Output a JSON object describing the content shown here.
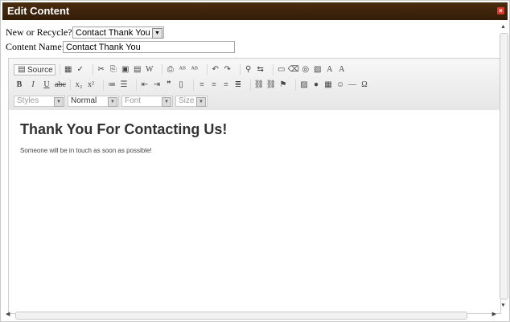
{
  "dialog": {
    "title": "Edit Content",
    "close_icon": "close-icon",
    "colors": {
      "title_bg": "#3d240b",
      "close_bg": "#d83a2a"
    }
  },
  "form": {
    "recycle_label": "New or Recycle?:",
    "recycle_value": "Contact Thank You",
    "name_label": "Content Name:",
    "name_value": "Contact Thank You"
  },
  "toolbar": {
    "source_label": "Source",
    "styles_label": "Styles",
    "format_label": "Normal",
    "font_label": "Font",
    "size_label": "Size"
  },
  "content": {
    "heading": "Thank You For Contacting Us!",
    "paragraph": "Someone will be in touch as soon as possible!"
  }
}
